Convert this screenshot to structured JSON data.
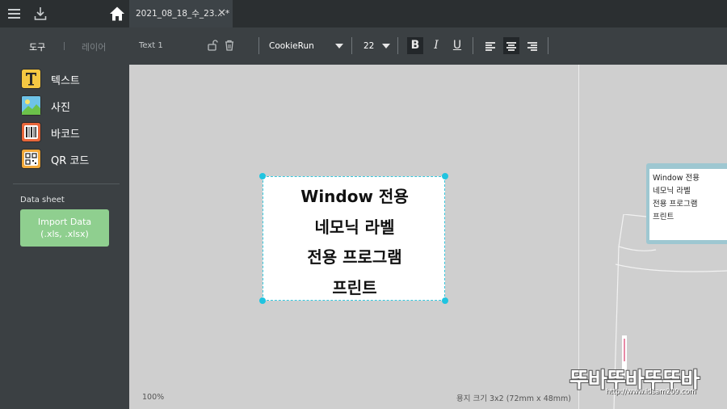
{
  "header": {
    "tab_title": "2021_08_18_수_23...",
    "tab_modified": "*",
    "tab_close": "✕"
  },
  "sidebar": {
    "tabs": [
      {
        "label": "도구",
        "active": true
      },
      {
        "label": "레이어",
        "active": false
      }
    ],
    "tools": [
      {
        "label": "텍스트",
        "icon": "text-icon"
      },
      {
        "label": "사진",
        "icon": "photo-icon"
      },
      {
        "label": "바코드",
        "icon": "barcode-icon"
      },
      {
        "label": "QR 코드",
        "icon": "qr-code-icon"
      }
    ],
    "data_sheet_label": "Data sheet",
    "import_button": {
      "line1": "Import Data",
      "line2": "(.xls, .xlsx)"
    }
  },
  "toolbar": {
    "element_name": "Text 1",
    "font_family": "CookieRun",
    "font_size": "22",
    "bold": "B",
    "italic": "I",
    "underline": "U",
    "alignment": "center"
  },
  "canvas": {
    "label_lines": [
      "Window 전용",
      "네모닉 라벨",
      "전용 프로그램",
      "프린트"
    ],
    "zoom": "100%",
    "paper_size": "용지 크기 3x2 (72mm x 48mm)"
  },
  "preview": {
    "lines": [
      "Window 전용",
      "네모닉 라벨",
      "전용 프로그램",
      "프린트"
    ]
  },
  "watermark": {
    "text": "뚜바뚜바뚜뚜바",
    "url": "http://www.idsam209.com"
  },
  "colors": {
    "sidebar_bg": "#3b4043",
    "topbar_bg": "#2b2f31",
    "canvas_bg": "#cfcfcf",
    "import_button": "#8fcf8f",
    "selection": "#38c6dc",
    "text_tool_icon": "#f5c842",
    "photo_tool_icon": "#6ec3e8",
    "barcode_tool_icon": "#e8663a",
    "qr_tool_icon": "#f2a93b"
  }
}
